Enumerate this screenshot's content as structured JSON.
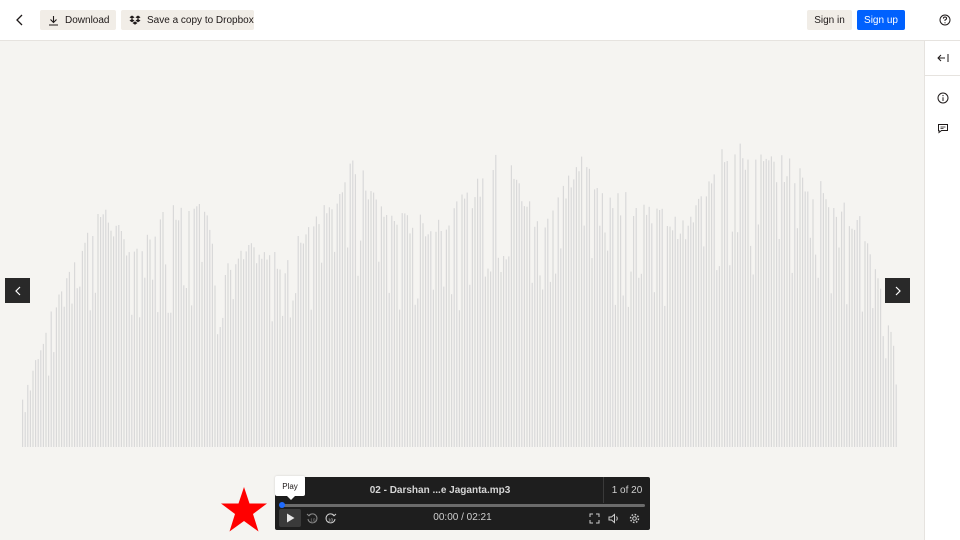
{
  "topbar": {
    "download_label": "Download",
    "dropbox_label": "Save a copy to Dropbox",
    "signin_label": "Sign in",
    "signup_label": "Sign up"
  },
  "player": {
    "track_name": "02 - Darshan ...e Jaganta.mp3",
    "track_count": "1 of 20",
    "time": "00:00 / 02:21",
    "progress": 0,
    "tooltip": "Play"
  },
  "colors": {
    "accent": "#0061fe",
    "viewer_bg": "#f5f4f1",
    "waveform_bar": "#d9d9d9",
    "player_bg": "#1e1e1e",
    "annotation_star": "#ff0000"
  },
  "icons": {
    "back": "chevron-left-icon",
    "download": "download-icon",
    "dropbox": "dropbox-icon",
    "help": "help-circle-icon",
    "collapse": "collapse-panel-icon",
    "info": "info-icon",
    "comment": "comment-icon",
    "prev": "chevron-left-icon",
    "next": "chevron-right-icon",
    "play": "play-icon",
    "rewind": "rewind-10-icon",
    "forward": "forward-10-icon",
    "fullscreen": "fullscreen-icon",
    "volume": "volume-icon",
    "settings": "settings-icon"
  }
}
